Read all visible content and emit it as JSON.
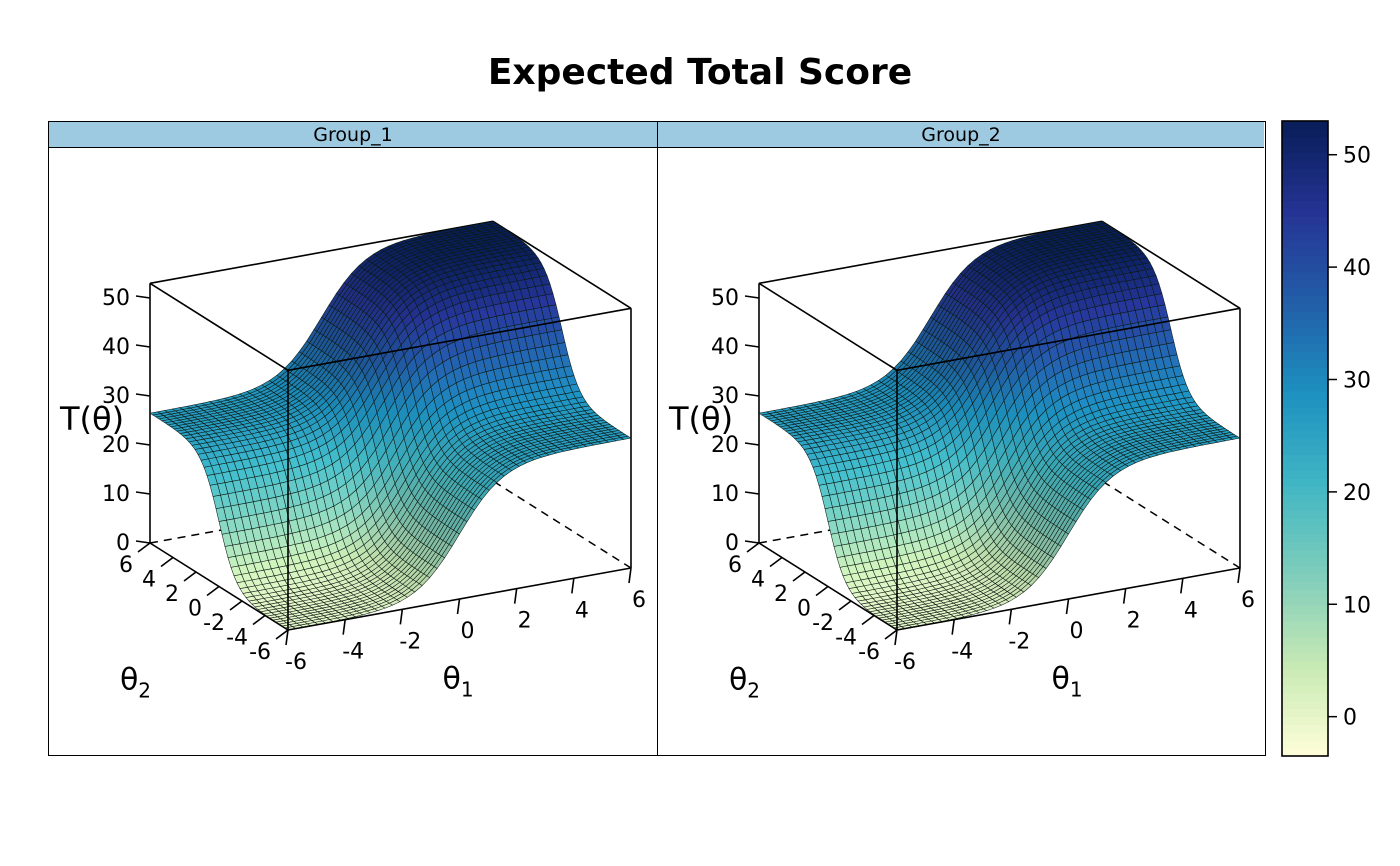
{
  "title": "Expected Total Score",
  "chart_data": {
    "type": "surface3d",
    "title": "Expected Total Score",
    "x_axis": {
      "label": "θ1",
      "ticks": [
        -6,
        -4,
        -2,
        0,
        2,
        4,
        6
      ],
      "range": [
        -6,
        6
      ]
    },
    "y_axis": {
      "label": "θ2",
      "ticks": [
        -6,
        -4,
        -2,
        0,
        2,
        4,
        6
      ],
      "range": [
        -6,
        6
      ]
    },
    "z_axis": {
      "label": "T(θ)",
      "ticks": [
        0,
        10,
        20,
        30,
        40,
        50
      ],
      "range": [
        0,
        53
      ]
    },
    "surface_function": "T = 26.5 * (logistic(1.3*θ1) + logistic(1.3*θ2))",
    "corner_values": {
      "θ1=-6,θ2=-6": 0,
      "θ1=6,θ2=-6": 26.5,
      "θ1=-6,θ2=6": 26.5,
      "θ1=6,θ2=6": 53
    },
    "panels": [
      {
        "name": "Group_1"
      },
      {
        "name": "Group_2"
      }
    ],
    "colorkey": {
      "ticks": [
        0,
        10,
        20,
        30,
        40,
        50
      ],
      "range": [
        -3.5,
        53
      ],
      "palette": [
        "#ffffd9",
        "#c7e9b4",
        "#7fcdbb",
        "#41b6c4",
        "#1d91c0",
        "#225ea8",
        "#253494",
        "#081d58"
      ]
    }
  }
}
